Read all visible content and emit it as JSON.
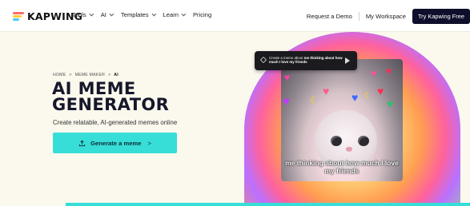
{
  "nav": {
    "brand": "KAPWING",
    "links": [
      "Tools",
      "AI",
      "Templates",
      "Learn",
      "Pricing"
    ],
    "request_demo": "Request a Demo",
    "workspace": "My Workspace",
    "try_free": "Try Kapwing Free"
  },
  "breadcrumb": [
    "HOME",
    ">",
    "MEME MAKER",
    ">",
    "AI"
  ],
  "hero": {
    "title_line1": "AI MEME",
    "title_line2": "GENERATOR",
    "subtitle": "Create relatable, AI-generated memes online",
    "cta_label": "Generate a meme",
    "cta_arrow": ">"
  },
  "prompt_card": {
    "lead": "Create a meme about",
    "bold": "me thinking about how much I love my friends"
  },
  "meme": {
    "caption": "me thinking about how much I love my friends"
  },
  "colors": {
    "accent": "#37ded8",
    "navy": "#0f0f2c",
    "background": "#fbf8ee"
  }
}
